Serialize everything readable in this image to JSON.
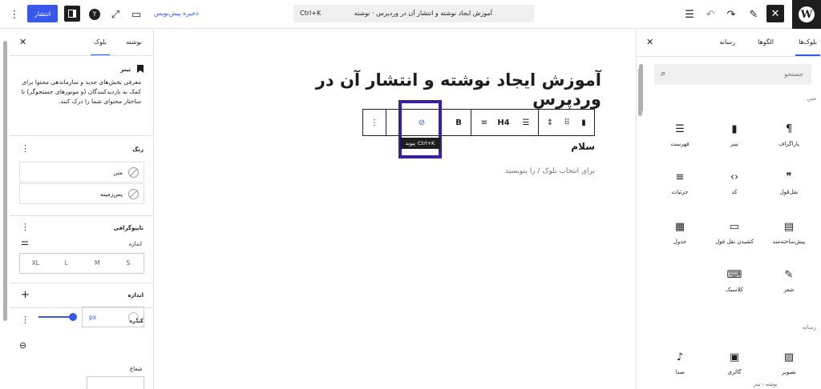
{
  "topbar": {
    "publish_label": "انتشار",
    "save_draft_label": "ذخیره پیش‌نویس",
    "doc_title": "آموزش ایجاد نوشته و انتشار آن در وردپرس · نوشته",
    "shortcut": "Ctrl+K"
  },
  "post": {
    "title": "آموزش ایجاد نوشته و انتشار آن در وردپرس",
    "paragraph": "سلام",
    "placeholder": "برای انتخاب بلوک / را بنویسید"
  },
  "toolbar": {
    "bold_label": "B",
    "heading_label": "H4",
    "tooltip_label": "پیوند",
    "tooltip_shortcut": "Ctrl+K"
  },
  "right_panel": {
    "tabs": [
      "بلوک‌ها",
      "الگوها",
      "رسانه"
    ],
    "search_placeholder": "جستجو",
    "category_text": "متن",
    "category_media": "رسانه",
    "text_blocks": [
      {
        "label": "پاراگراف",
        "icon": "paragraph-icon",
        "glyph": "¶"
      },
      {
        "label": "تیتر",
        "icon": "heading-bookmark-icon",
        "glyph": "▮"
      },
      {
        "label": "فهرست",
        "icon": "list-icon",
        "glyph": "☰"
      },
      {
        "label": "نقل‌قول",
        "icon": "quote-icon",
        "glyph": "❞"
      },
      {
        "label": "کد",
        "icon": "code-icon",
        "glyph": "‹›"
      },
      {
        "label": "جزئیات",
        "icon": "details-icon",
        "glyph": "≡"
      },
      {
        "label": "پیش‌ساخته‌مند",
        "icon": "preformatted-icon",
        "glyph": "▤"
      },
      {
        "label": "کشیدن نقل قول",
        "icon": "pullquote-icon",
        "glyph": "▭"
      },
      {
        "label": "جدول",
        "icon": "table-icon",
        "glyph": "▦"
      },
      {
        "label": "شعر",
        "icon": "verse-icon",
        "glyph": "✎"
      },
      {
        "label": "کلاسیک",
        "icon": "classic-keyboard-icon",
        "glyph": "⌨"
      }
    ],
    "media_blocks": [
      {
        "label": "تصویر",
        "icon": "image-icon",
        "glyph": "▨"
      },
      {
        "label": "گالری",
        "icon": "gallery-icon",
        "glyph": "▣"
      },
      {
        "label": "صدا",
        "icon": "audio-icon",
        "glyph": "♪"
      }
    ]
  },
  "left_panel": {
    "tabs": [
      "نوشته",
      "بلوک"
    ],
    "block_name": "تیتر",
    "block_description": "معرفی بخش‌های جدید و سازماندهی محتوا برای کمک به بازدیدکنندگان (و موتورهای جستجوگر) تا ساختار محتوای شما را درک کنند.",
    "color_title": "رنگ",
    "color_text": "متن",
    "color_background": "پس‌زمینه",
    "typography_title": "تایپوگرافی",
    "size_label": "اندازه",
    "sizes": [
      "S",
      "M",
      "L",
      "XL"
    ],
    "dimensions_title": "اندازه",
    "border_title": "کناره",
    "unit": "px",
    "radius_label": "شعاع"
  },
  "footer": {
    "text": "نوشته  ‹  تیتر"
  },
  "colors": {
    "accent": "#3858e9",
    "highlight": "#3a1f9e",
    "dark": "#1e1e1e"
  }
}
